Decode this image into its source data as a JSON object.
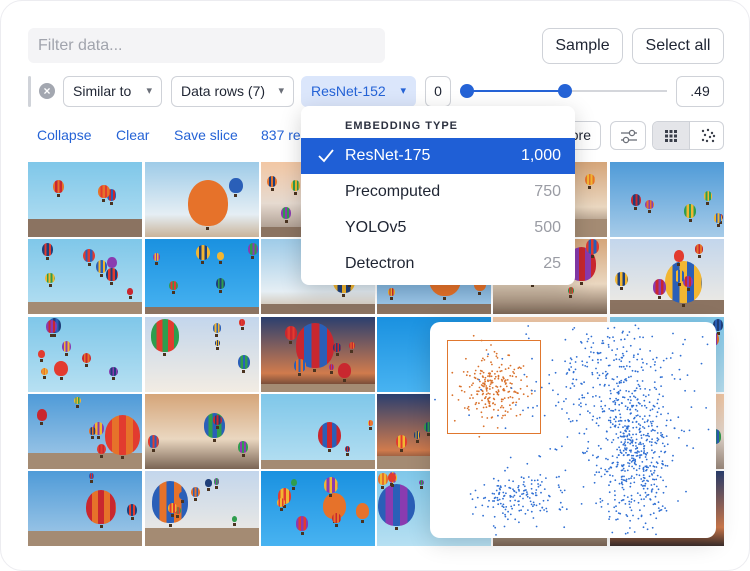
{
  "filter": {
    "placeholder": "Filter data..."
  },
  "buttons": {
    "sample": "Sample",
    "select_all": "Select all"
  },
  "filter_row": {
    "similar_to": "Similar to",
    "data_rows": "Data rows (7)",
    "model": "ResNet-152",
    "range_min": "0",
    "range_max": ".49",
    "range_fraction": {
      "low": 0.0,
      "high": 0.49
    }
  },
  "actions": {
    "collapse": "Collapse",
    "clear": "Clear",
    "save_slice": "Save slice",
    "count": "837 re",
    "more": "ore"
  },
  "dropdown": {
    "header": "EMBEDDING TYPE",
    "items": [
      {
        "label": "ResNet-175",
        "count": "1,000",
        "selected": true
      },
      {
        "label": "Precomputed",
        "count": "750",
        "selected": false
      },
      {
        "label": "YOLOv5",
        "count": "500",
        "selected": false
      },
      {
        "label": "Detectron",
        "count": "25",
        "selected": false
      }
    ]
  },
  "colors": {
    "accent": "#2563d6",
    "selection": "#1f5fd6",
    "lasso": "#e0772e",
    "points_selected": "#d9712b",
    "points": "#2f6fd3"
  },
  "icons": {
    "clear": "close-circle-icon",
    "chevron": "chevron-down-icon",
    "check": "check-icon",
    "filters": "sliders-icon",
    "grid_view": "grid-view-icon",
    "scatter_view": "scatter-view-icon"
  }
}
